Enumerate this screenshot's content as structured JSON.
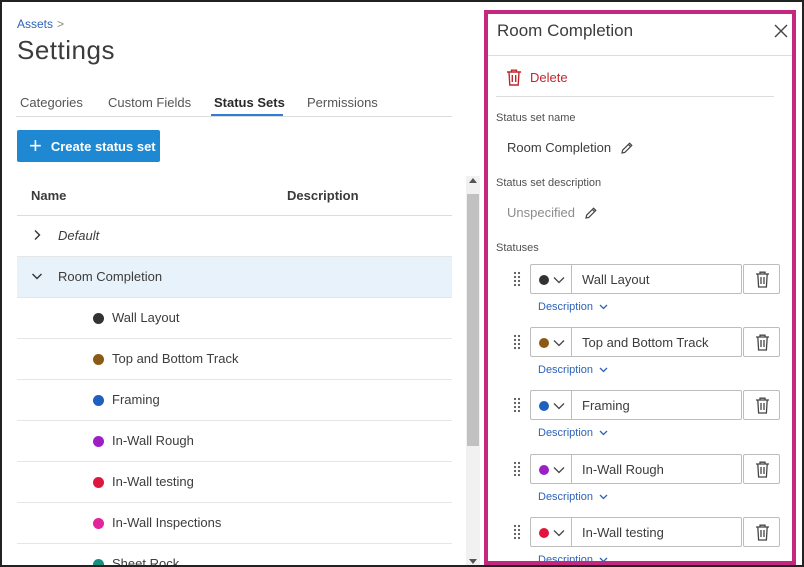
{
  "breadcrumb": {
    "label": "Assets",
    "separator": ">"
  },
  "page_title": "Settings",
  "tabs": [
    {
      "label": "Categories"
    },
    {
      "label": "Custom Fields"
    },
    {
      "label": "Status Sets"
    },
    {
      "label": "Permissions"
    }
  ],
  "active_tab": "Status Sets",
  "create_button": {
    "icon": "+",
    "label": "Create status set"
  },
  "table": {
    "columns": {
      "name": "Name",
      "description": "Description"
    },
    "rows": [
      {
        "name": "Default",
        "expanded": false
      },
      {
        "name": "Room Completion",
        "expanded": true,
        "selected": true
      }
    ],
    "children": [
      {
        "name": "Wall Layout",
        "color": "#333333"
      },
      {
        "name": "Top and Bottom Track",
        "color": "#8b5a14"
      },
      {
        "name": "Framing",
        "color": "#1f5fbf"
      },
      {
        "name": "In-Wall Rough",
        "color": "#9c1fc6"
      },
      {
        "name": "In-Wall testing",
        "color": "#e0163c"
      },
      {
        "name": "In-Wall Inspections",
        "color": "#e0269a"
      },
      {
        "name": "Sheet Rock",
        "color": "#16917f"
      }
    ]
  },
  "panel": {
    "title": "Room Completion",
    "delete_label": "Delete",
    "name_label": "Status set name",
    "name_value": "Room Completion",
    "desc_label": "Status set description",
    "desc_value": "Unspecified",
    "statuses_label": "Statuses",
    "description_link": "Description",
    "statuses": [
      {
        "name": "Wall Layout",
        "color": "#333333"
      },
      {
        "name": "Top and Bottom Track",
        "color": "#8b5a14"
      },
      {
        "name": "Framing",
        "color": "#1f5fbf"
      },
      {
        "name": "In-Wall Rough",
        "color": "#9c1fc6"
      },
      {
        "name": "In-Wall testing",
        "color": "#e0163c"
      }
    ]
  },
  "colors": {
    "accent": "#1e88d2",
    "panel_border": "#c3277e",
    "danger": "#c0272d",
    "link": "#2c63b8",
    "selected_row": "#e8f2fb"
  }
}
